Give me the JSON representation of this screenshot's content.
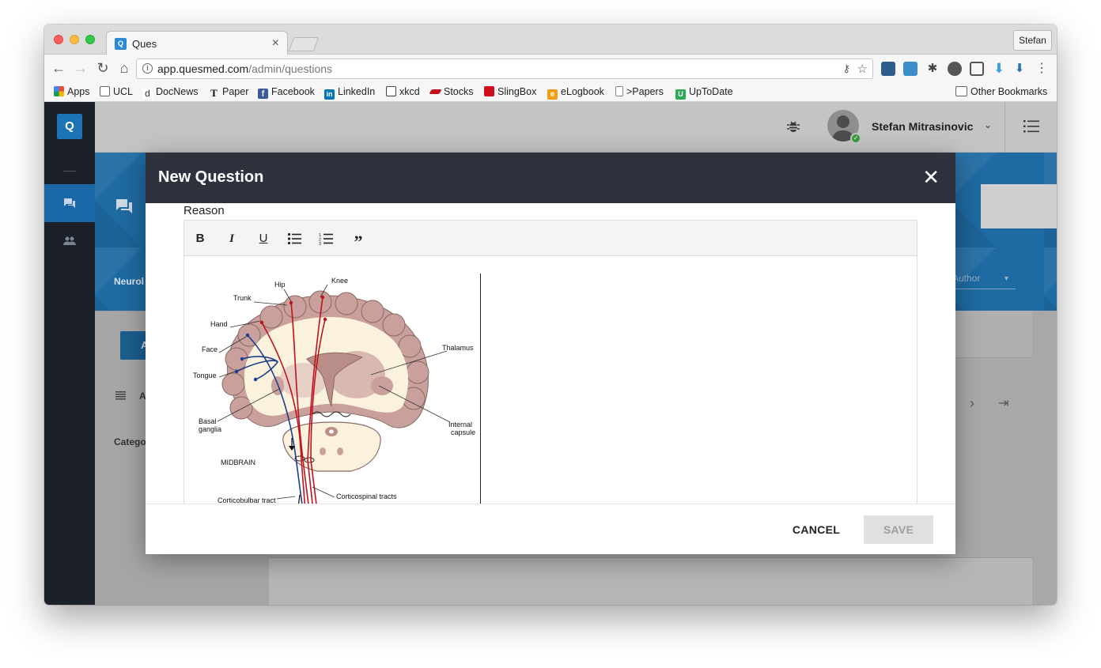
{
  "browser": {
    "tab": {
      "title": "Ques",
      "favicon": "Q",
      "close": "×"
    },
    "profile": "Stefan",
    "url": {
      "host": "app.quesmed.com",
      "path": "/admin/questions"
    },
    "bookmarks": [
      {
        "label": "Apps",
        "icon": "apps-grid-icon",
        "color": "#e44d3a"
      },
      {
        "label": "UCL",
        "icon": "folder-icon",
        "color": "#666666"
      },
      {
        "label": "DocNews",
        "icon": "docnews-icon",
        "color": "#333333"
      },
      {
        "label": "Paper",
        "icon": "nyt-icon",
        "color": "#111111"
      },
      {
        "label": "Facebook",
        "icon": "facebook-icon",
        "color": "#3b5998"
      },
      {
        "label": "LinkedIn",
        "icon": "linkedin-icon",
        "color": "#0077b5"
      },
      {
        "label": "xkcd",
        "icon": "xkcd-icon",
        "color": "#444444"
      },
      {
        "label": "Stocks",
        "icon": "stocks-icon",
        "color": "#c0121c"
      },
      {
        "label": "SlingBox",
        "icon": "slingbox-icon",
        "color": "#d0101c"
      },
      {
        "label": "eLogbook",
        "icon": "elogbook-icon",
        "color": "#f39c12"
      },
      {
        "label": ">Papers",
        "icon": "page-icon",
        "color": "#888888"
      },
      {
        "label": "UpToDate",
        "icon": "uptodate-icon",
        "color": "#2eaa55"
      }
    ],
    "other_bookmarks": "Other Bookmarks"
  },
  "app": {
    "logo": "Q",
    "user": {
      "name": "Stefan Mitrasinovic"
    },
    "banner_label": "Neurol",
    "author_placeholder": "Author",
    "add_button": "A",
    "list_label": "A",
    "category_label": "Catego"
  },
  "modal": {
    "title": "New Question",
    "close": "✕",
    "field_label": "Reason",
    "toolbar": [
      "B",
      "I",
      "U",
      "bulleted-list",
      "numbered-list",
      "quote"
    ],
    "diagram_labels": {
      "knee": "Knee",
      "hip": "Hip",
      "trunk": "Trunk",
      "hand": "Hand",
      "face": "Face",
      "tongue": "Tongue",
      "basal1": "Basal",
      "basal2": "ganglia",
      "thalamus": "Thalamus",
      "internal1": "Internal",
      "internal2": "capsule",
      "midbrain": "MIDBRAIN",
      "corticobulbar": "Corticobulbar tract",
      "corticospinal": "Corticospinal tracts"
    },
    "cancel": "CANCEL",
    "save": "SAVE"
  },
  "colors": {
    "modal_header": "#2d323d",
    "brand_blue": "#1d74b4",
    "cortex": "#c9a09b",
    "white_matter": "#fbf2dd",
    "tract_red": "#c0121c",
    "tract_blue": "#1a3f8f"
  }
}
